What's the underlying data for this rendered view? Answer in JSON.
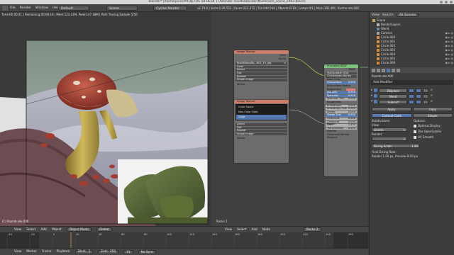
{
  "title": "Blender* [/home/joner/PROJETOS U8 DESK 17/Blender Assets/Blender/Mushroom_scene_int02.blend]",
  "info_bar": {
    "menus": [
      "File",
      "Render",
      "Window",
      "Help"
    ],
    "layout": "Default",
    "scene": "Scene",
    "engine": "Cycles Render",
    "stats": "v2.79.6 | Verts:2,26,552 | Faces:223,572 | Tris:240,544 | Objects:0/19 | Lamps:0/1 | Mem:393.4M | Rozmo.ske.000"
  },
  "viewport": {
    "status": "Time:00:00:41 | Remaining:00:06:16 | Mem:123.21M, Peak:147.18M | Path Tracing Sample 5/50",
    "object_label": "(1) Rozmb.ske.000"
  },
  "node_editor": {
    "label": "Rocks 2",
    "image_node": {
      "title": "Image Texture",
      "outputs": [
        "Color",
        "Alpha"
      ],
      "image": "RockMossyRo...R01_1k_jpg",
      "color": "Color",
      "interpolation": "Linear",
      "projection": "Flat",
      "extension": "Repeat",
      "source": "Single Image",
      "vector": "Vector"
    },
    "image_node2": {
      "title": "Image Texture",
      "menu": [
        "Color Space",
        "Non-Color Data",
        "Color"
      ],
      "fields": [
        "Linear",
        "Flat",
        "Repeat",
        "Single Image"
      ],
      "vector": "Vector"
    },
    "bsdf_node": {
      "title": "Principled BSDF",
      "output": "BSDF",
      "distribution": "Multiscatter GGX",
      "subsurface_method": "Christensen-Burley",
      "rows": [
        {
          "label": "Base Color",
          "value": ""
        },
        {
          "label": "Subsurface:",
          "value": "0.000"
        },
        {
          "label": "Subsurface Radius",
          "value": ""
        },
        {
          "label": "Subsurface Color",
          "value": ""
        },
        {
          "label": "Metallic:",
          "value": "0.000"
        },
        {
          "label": "Specular:",
          "value": "0.500"
        },
        {
          "label": "Specular Tint:",
          "value": "0.000"
        },
        {
          "label": "Roughness",
          "value": ""
        },
        {
          "label": "Anisotropic:",
          "value": "0.000"
        },
        {
          "label": "Anisotropic Rot:",
          "value": "0.000"
        },
        {
          "label": "Sheen:",
          "value": "0.000"
        },
        {
          "label": "Sheen Tint:",
          "value": "0.500"
        },
        {
          "label": "Clearcoat:",
          "value": "0.000"
        },
        {
          "label": "Clearcoat Rough:",
          "value": "0.030"
        },
        {
          "label": "IOR:",
          "value": "1.450"
        },
        {
          "label": "Transmission:",
          "value": "0.000"
        },
        {
          "label": "Normal",
          "value": ""
        },
        {
          "label": "Clearcoat Normal",
          "value": ""
        },
        {
          "label": "Tangent",
          "value": ""
        }
      ]
    }
  },
  "outliner": {
    "view": "View",
    "search": "Search",
    "scope": "All Scenes",
    "items": [
      "Scene",
      "RenderLayers",
      "World",
      "Camera",
      "Circle.000",
      "Circle.001",
      "Circle.002",
      "Circle.003",
      "Circle.004",
      "Circle.005",
      "Circle.006"
    ]
  },
  "properties": {
    "object_name": "Rozmb.ske.000",
    "add_modifier": "Add Modifier",
    "modifiers": [
      "Displace",
      "Bend",
      "Subsurf"
    ],
    "apply": "Apply",
    "copy": "Copy",
    "tabs": [
      "Catmull-Clark",
      "Simple"
    ],
    "subdivisions": "Subdivisions:",
    "view_label": "View:",
    "levels": "Levels:",
    "levels_value": "1",
    "render_label": "Render:",
    "render_value": "2",
    "options": "Options:",
    "optimal_display": "Optimal Display",
    "use_opensubdiv": "Use OpenSubdiv",
    "uv_smooth": "UV Smooth",
    "dicing": "Dicing Scale:",
    "dicing_value": "1.00",
    "final_dicing": "Final Dicing Rate:",
    "final_dicing_value": "Render 1.00 px, Preview 8.00 px"
  },
  "viewport_header": {
    "menus": [
      "View",
      "Select",
      "Add",
      "Object"
    ],
    "mode": "Object Mode",
    "pivot": "Global"
  },
  "node_header": {
    "menus": [
      "View",
      "Select",
      "Add",
      "Node"
    ],
    "material": "Rocks 2"
  },
  "timeline_header": {
    "menus": [
      "View",
      "Marker",
      "Frame",
      "Playback"
    ],
    "start_label": "Start:",
    "start": "1",
    "end_label": "End:",
    "end": "250",
    "current": "31",
    "sync": "No Sync"
  },
  "timeline_ticks": [
    "-40",
    "-20",
    "0",
    "20",
    "40",
    "60",
    "80",
    "100",
    "120",
    "140",
    "160",
    "180",
    "200",
    "220",
    "240",
    "260"
  ],
  "colors": {
    "accent": "#5679b1",
    "image_node_header": "#cd7e6a",
    "bsdf_node_header": "#7fc17f",
    "cursor_line": "#f0bb2a"
  }
}
